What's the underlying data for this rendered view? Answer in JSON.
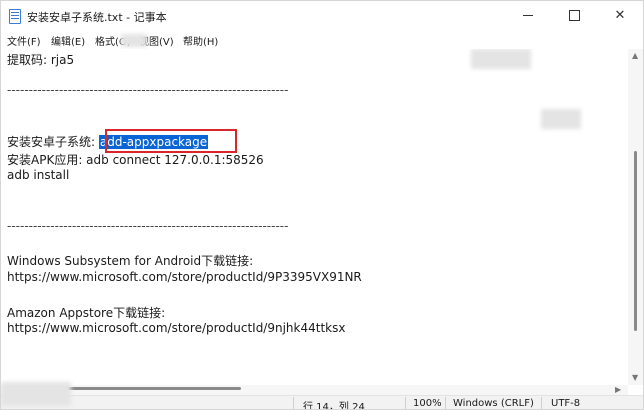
{
  "window": {
    "title": "安装安卓子系统.txt - 记事本"
  },
  "menu": [
    "文件(F)",
    "编辑(E)",
    "格式(O)",
    "视图(V)",
    "帮助(H)"
  ],
  "editor": {
    "lines": [
      "提取码: rja5",
      "-----------------------------------------------------------------",
      "安装安卓子系统: ",
      "add-appxpackage",
      "安装APK应用: adb connect 127.0.0.1:58526",
      "adb install",
      "-----------------------------------------------------------------",
      "Windows Subsystem for Android下载链接:",
      "https://www.microsoft.com/store/productId/9P3395VX91NR",
      "Amazon Appstore下载链接:",
      "https://www.microsoft.com/store/productId/9njhk44ttksx"
    ]
  },
  "status": {
    "position": "行 14，列 24",
    "zoom": "100%",
    "line_ending": "Windows (CRLF)",
    "encoding": "UTF-8"
  },
  "colors": {
    "selection": "#0a64d4",
    "highlight_border": "#d9262b"
  },
  "icons": [
    "notepad-icon",
    "minimize-icon",
    "maximize-icon",
    "close-icon"
  ]
}
